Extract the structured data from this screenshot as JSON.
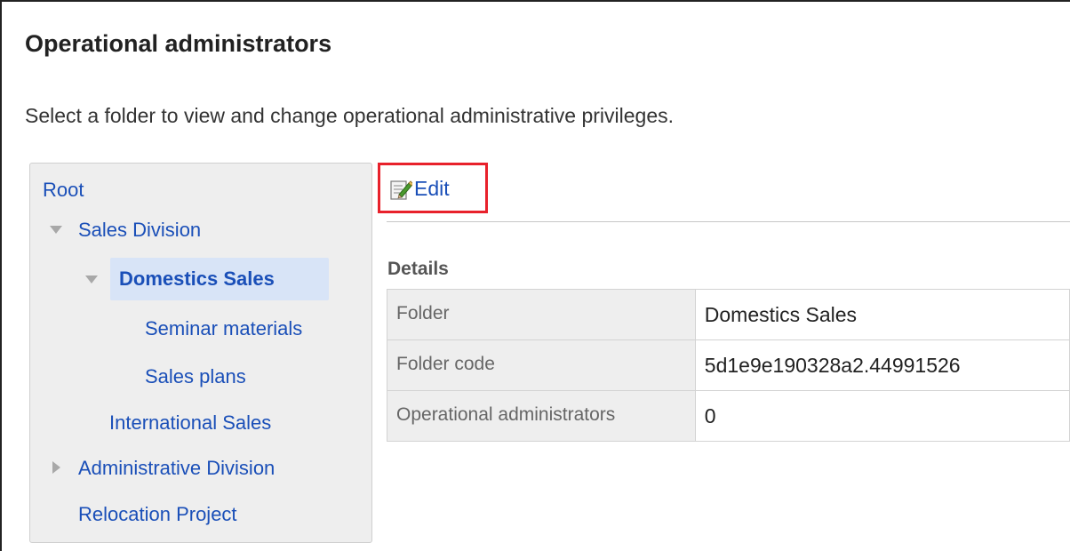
{
  "page": {
    "title": "Operational administrators",
    "description": "Select a folder to view and change operational administrative privileges."
  },
  "tree": {
    "root": "Root",
    "sales_division": "Sales Division",
    "domestics_sales": "Domestics Sales",
    "seminar_materials": "Seminar materials",
    "sales_plans": "Sales plans",
    "international_sales": "International Sales",
    "administrative_division": "Administrative Division",
    "relocation_project": "Relocation Project",
    "expanded_icon": "triangle-down-icon",
    "collapsed_icon": "triangle-right-icon"
  },
  "toolbar": {
    "edit_label": "Edit",
    "edit_icon": "edit-note-icon",
    "highlight_color": "#e8212b"
  },
  "details": {
    "title": "Details",
    "rows": [
      {
        "label": "Folder",
        "value": "Domestics Sales"
      },
      {
        "label": "Folder code",
        "value": "5d1e9e190328a2.44991526"
      },
      {
        "label": "Operational administrators",
        "value": "0"
      }
    ]
  },
  "colors": {
    "link": "#1a4fb8",
    "selected_bg": "#d8e4f7",
    "panel_bg": "#eeeeee"
  }
}
